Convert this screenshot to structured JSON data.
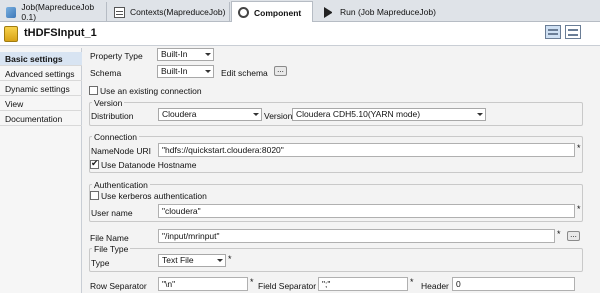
{
  "tabs": [
    {
      "label": "Job(MapreduceJob 0.1)"
    },
    {
      "label": "Contexts(MapreduceJob)"
    },
    {
      "label": "Component"
    },
    {
      "label": "Run (Job MapreduceJob)"
    }
  ],
  "component": {
    "title": "tHDFSInput_1"
  },
  "sidebar": {
    "items": [
      {
        "label": "Basic settings"
      },
      {
        "label": "Advanced settings"
      },
      {
        "label": "Dynamic settings"
      },
      {
        "label": "View"
      },
      {
        "label": "Documentation"
      }
    ]
  },
  "form": {
    "property_type": {
      "label": "Property Type",
      "value": "Built-In"
    },
    "schema": {
      "label": "Schema",
      "value": "Built-In",
      "edit_label": "Edit schema",
      "button": "..."
    },
    "use_existing": {
      "label": "Use an existing connection",
      "checked": false
    },
    "version": {
      "group": "Version",
      "distribution_label": "Distribution",
      "distribution_value": "Cloudera",
      "version_label": "Version",
      "version_value": "Cloudera CDH5.10(YARN mode)"
    },
    "connection": {
      "group": "Connection",
      "namenode_label": "NameNode URI",
      "namenode_value": "\"hdfs://quickstart.cloudera:8020\"",
      "datanode_label": "Use Datanode Hostname",
      "datanode_checked": true
    },
    "auth": {
      "group": "Authentication",
      "kerberos_label": "Use kerberos authentication",
      "kerberos_checked": false,
      "username_label": "User name",
      "username_value": "\"cloudera\""
    },
    "file_name": {
      "label": "File Name",
      "value": "\"/input/mrinput\"",
      "button": "..."
    },
    "file_type": {
      "group": "File Type",
      "type_label": "Type",
      "type_value": "Text File"
    },
    "row_separator": {
      "label": "Row Separator",
      "value": "\"\\n\""
    },
    "field_separator": {
      "label": "Field Separator",
      "value": "\";\""
    },
    "header": {
      "label": "Header",
      "value": "0"
    },
    "required_mark": "*"
  }
}
